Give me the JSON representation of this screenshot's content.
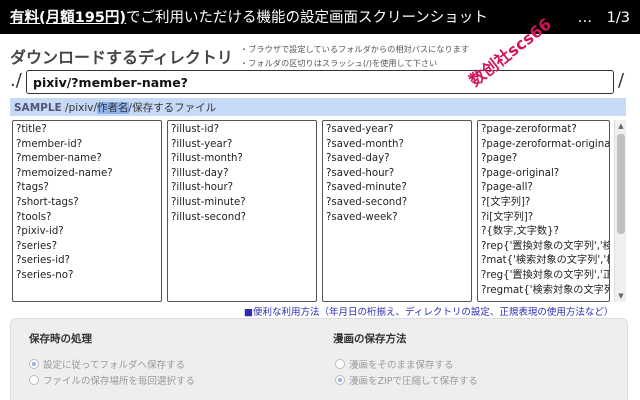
{
  "titlebar": {
    "bold_text": "有料(月額195円)",
    "rest_text": "でご利用いただける機能の設定画面スクリーンショット",
    "page_indicator": "…　1/3"
  },
  "heading": "ダウンロードするディレクトリ",
  "notes": [
    "・ブラウザで設定しているフォルダからの相対パスになります",
    "・フォルダの区切りはスラッシュ(/)を使用して下さい"
  ],
  "path": {
    "prefix": "./",
    "value": "pixiv/?member-name?",
    "suffix": "/"
  },
  "sample": {
    "label": "SAMPLE",
    "before": " /pixiv/",
    "highlight": "作者名",
    "after": "/保存するファイル"
  },
  "watermark": "数创社scs66",
  "placeholder_columns": [
    [
      "?title?",
      "?member-id?",
      "?member-name?",
      "?memoized-name?",
      "?tags?",
      "?short-tags?",
      "?tools?",
      "?pixiv-id?",
      "?series?",
      "?series-id?",
      "?series-no?"
    ],
    [
      "?illust-id?",
      "?illust-year?",
      "?illust-month?",
      "?illust-day?",
      "?illust-hour?",
      "?illust-minute?",
      "?illust-second?"
    ],
    [
      "?saved-year?",
      "?saved-month?",
      "?saved-day?",
      "?saved-hour?",
      "?saved-minute?",
      "?saved-second?",
      "?saved-week?"
    ],
    [
      "?page-zeroformat?",
      "?page-zeroformat-original?",
      "?page?",
      "?page-original?",
      "?page-all?",
      "?[文字列]?",
      "?i[文字列]?",
      "?{数字,文字数}?",
      "?rep{'置換対象の文字列','検索",
      "?mat{'検索対象の文字列','検",
      "?reg{'置換対象の文字列','正規",
      "?regmat{'検索対象の文字列'"
    ]
  ],
  "help_link": {
    "bullet": "■",
    "text": "便利な利用方法（年月日の桁揃え、ディレクトリの設定、正規表現の使用方法など）"
  },
  "save_section": {
    "title": "保存時の処理",
    "options": [
      {
        "label": "設定に従ってフォルダへ保存する",
        "selected": true
      },
      {
        "label": "ファイルの保存場所を毎回選択する",
        "selected": false
      }
    ]
  },
  "manga_section": {
    "title": "漫画の保存方法",
    "options": [
      {
        "label": "漫画をそのまま保存する",
        "selected": false
      },
      {
        "label": "漫画をZIPで圧縮して保存する",
        "selected": true
      }
    ]
  }
}
